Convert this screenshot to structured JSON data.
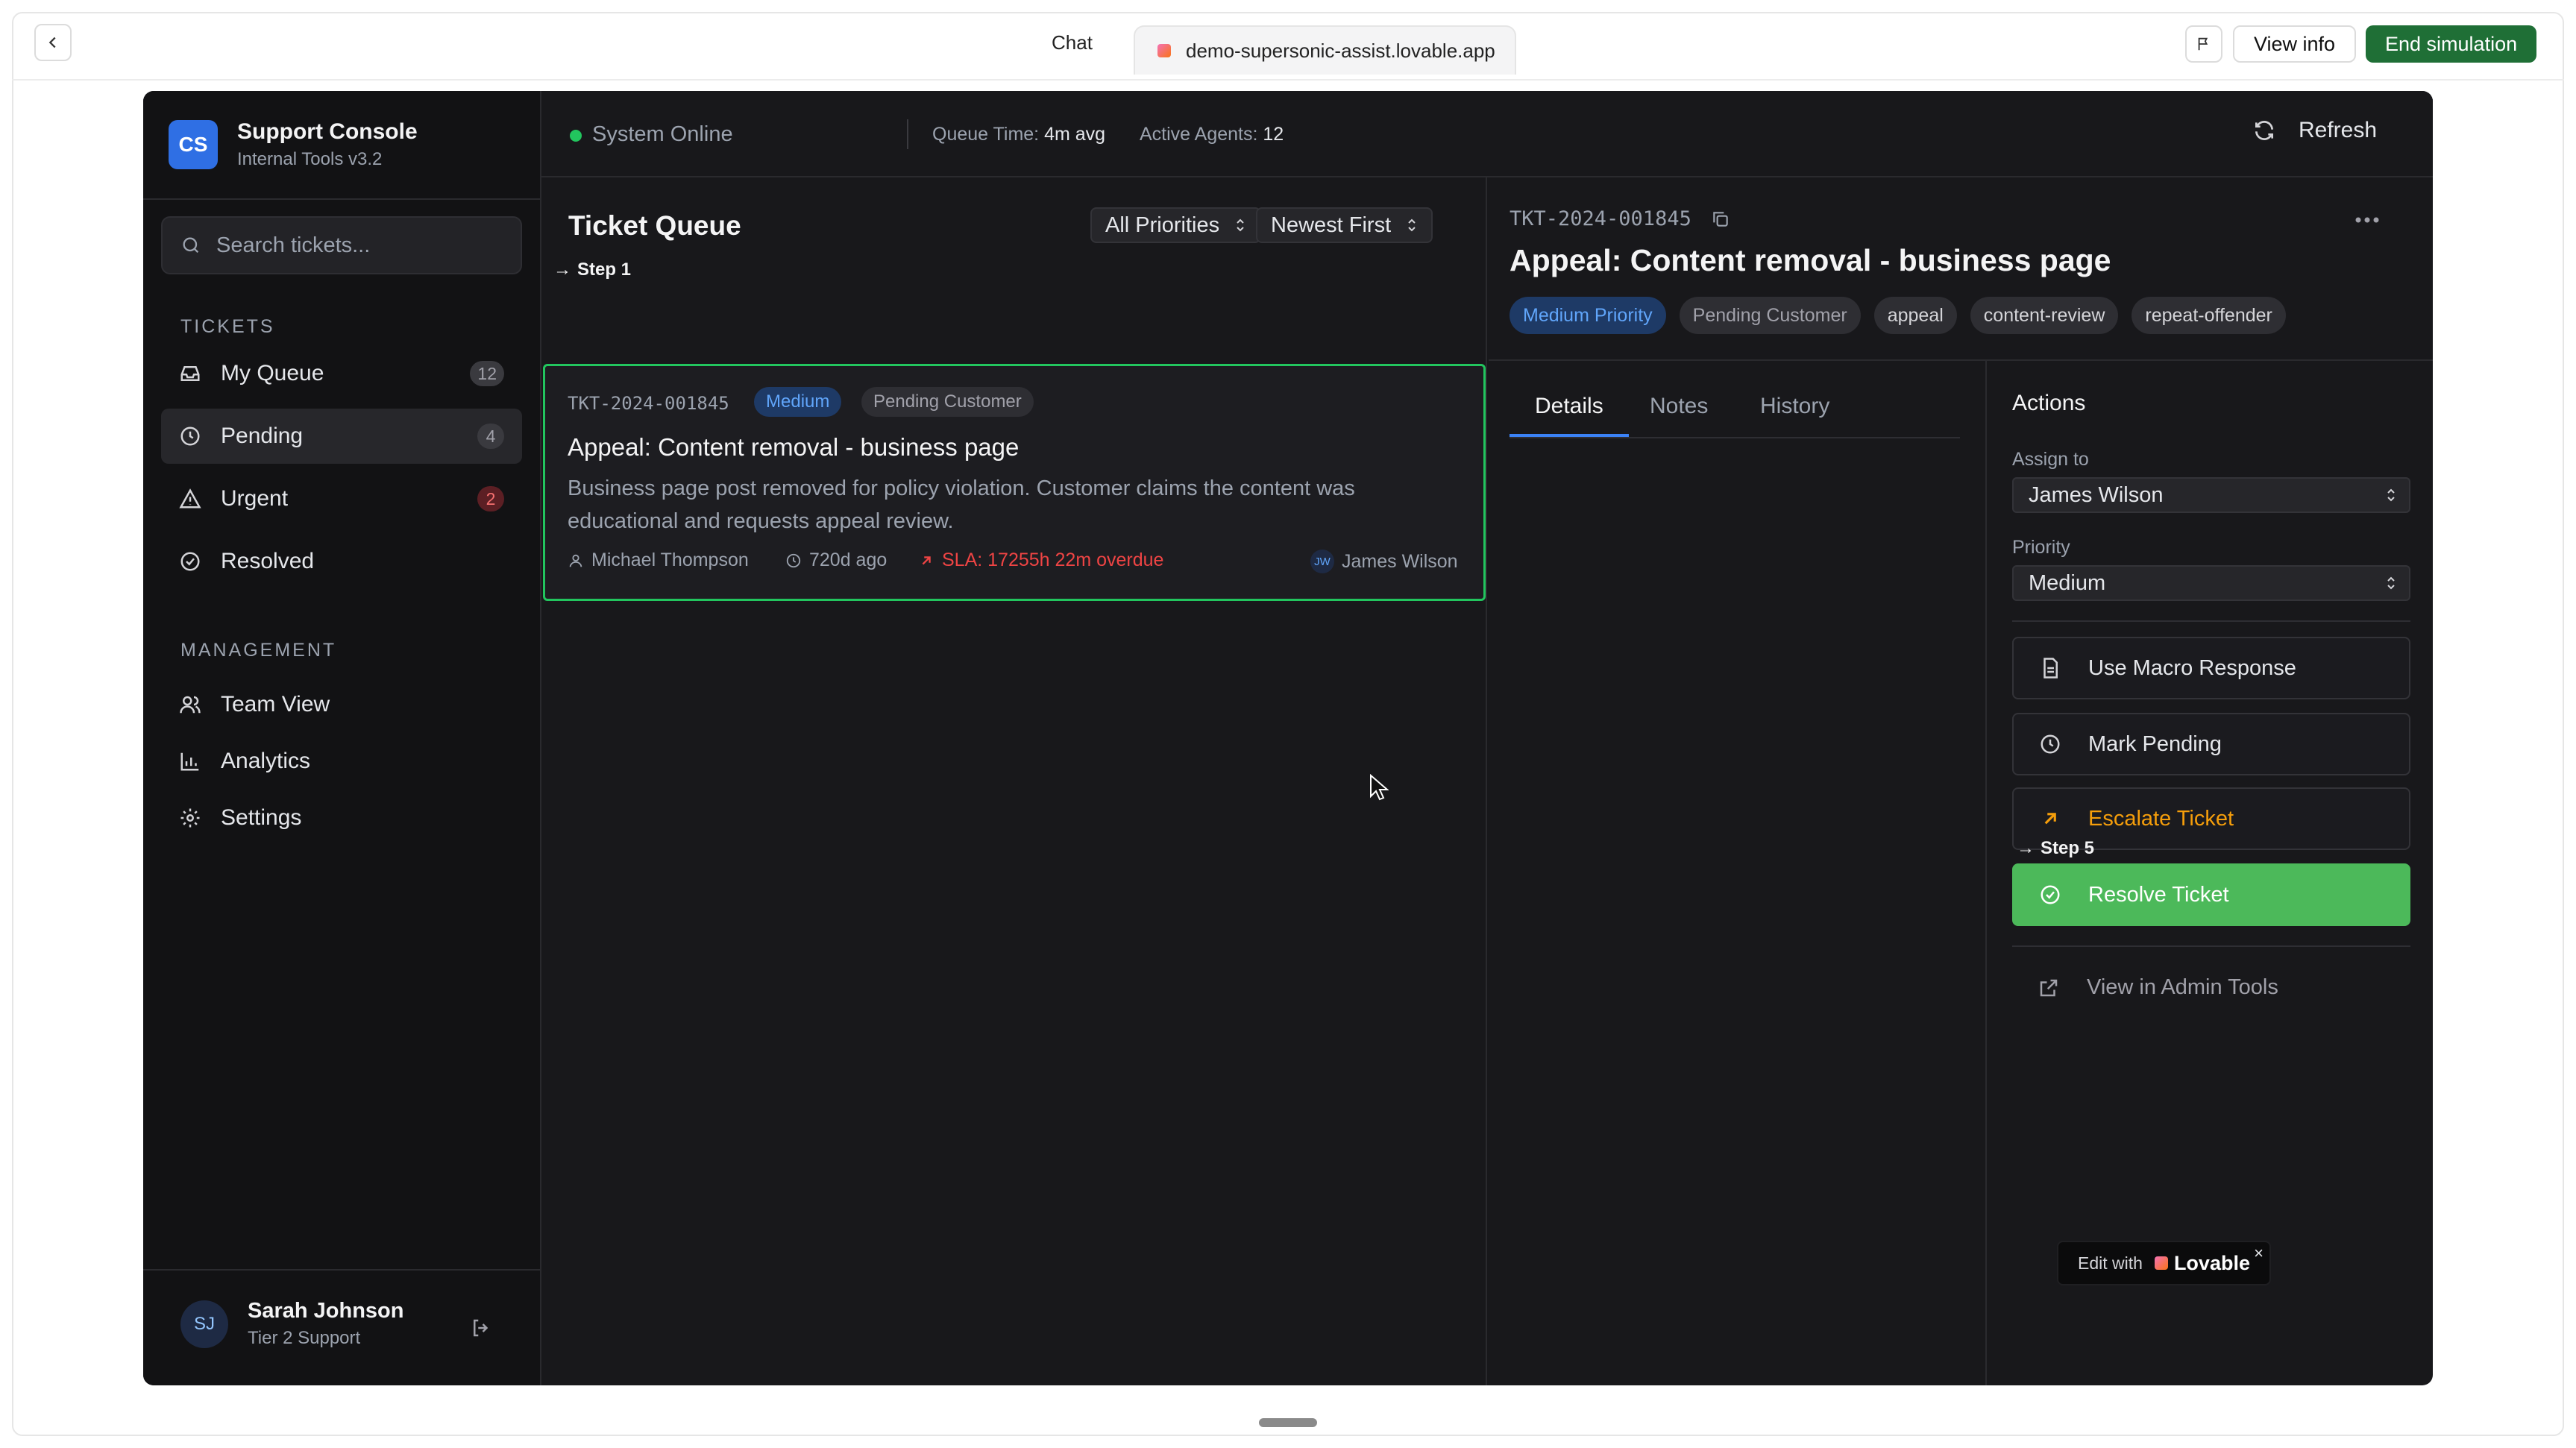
{
  "browser": {
    "chat_tab": "Chat",
    "url_tab": "demo-supersonic-assist.lovable.app",
    "view_info": "View info",
    "end_simulation": "End simulation"
  },
  "sidebar": {
    "brand_initials": "CS",
    "brand_title": "Support Console",
    "brand_subtitle": "Internal Tools v3.2",
    "search_placeholder": "Search tickets...",
    "tickets_label": "TICKETS",
    "tickets": [
      {
        "label": "My Queue",
        "badge": "12",
        "icon": "inbox-icon"
      },
      {
        "label": "Pending",
        "badge": "4",
        "icon": "clock-icon"
      },
      {
        "label": "Urgent",
        "badge": "2",
        "icon": "warning-icon"
      },
      {
        "label": "Resolved",
        "icon": "check-circle-icon"
      }
    ],
    "management_label": "MANAGEMENT",
    "management": [
      {
        "label": "Team View",
        "icon": "users-icon"
      },
      {
        "label": "Analytics",
        "icon": "bar-chart-icon"
      },
      {
        "label": "Settings",
        "icon": "gear-icon"
      }
    ],
    "user": {
      "initials": "SJ",
      "name": "Sarah Johnson",
      "role": "Tier 2 Support"
    }
  },
  "header": {
    "status": "System Online",
    "queue_time_label": "Queue Time:",
    "queue_time_value": "4m avg",
    "agents_label": "Active Agents:",
    "agents_value": "12",
    "refresh": "Refresh"
  },
  "queue": {
    "title": "Ticket Queue",
    "step1": "Step 1",
    "priority_filter": "All Priorities",
    "sort": "Newest First",
    "ticket": {
      "id": "TKT-2024-001845",
      "priority": "Medium",
      "status": "Pending Customer",
      "title": "Appeal: Content removal - business page",
      "description": "Business page post removed for policy violation. Customer claims the content was educational and requests appeal review.",
      "customer": "Michael Thompson",
      "age": "720d ago",
      "sla": "SLA: 17255h 22m overdue",
      "assignee_initials": "JW",
      "assignee": "James Wilson"
    }
  },
  "detail": {
    "id": "TKT-2024-001845",
    "title": "Appeal: Content removal - business page",
    "tags": [
      "Medium Priority",
      "Pending Customer",
      "appeal",
      "content-review",
      "repeat-offender"
    ],
    "tabs": [
      "Details",
      "Notes",
      "History"
    ],
    "actions": {
      "title": "Actions",
      "assign_label": "Assign to",
      "assign_value": "James Wilson",
      "priority_label": "Priority",
      "priority_value": "Medium",
      "macro": "Use Macro Response",
      "pending": "Mark Pending",
      "escalate": "Escalate Ticket",
      "step5": "Step 5",
      "resolve": "Resolve Ticket",
      "admin": "View in Admin Tools"
    }
  },
  "lovable": {
    "edit_with": "Edit with",
    "brand": "Lovable",
    "close": "×"
  },
  "colors": {
    "accent": "#3b82f6",
    "success": "#4cb95a",
    "danger": "#ef4444",
    "warning": "#f59e0b",
    "end_button": "#1f6f36"
  }
}
